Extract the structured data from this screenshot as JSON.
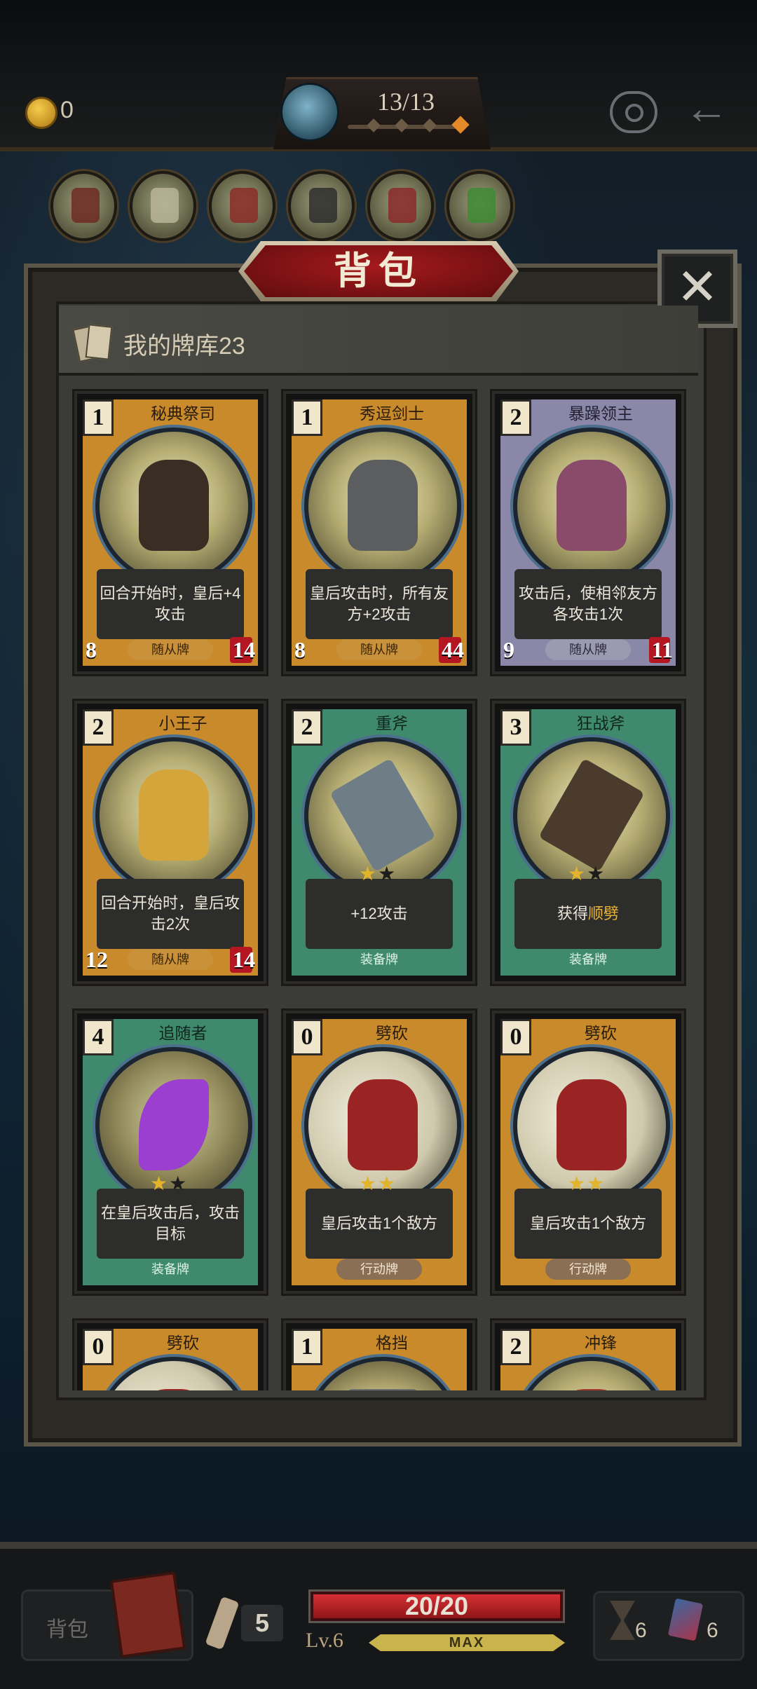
{
  "topbar": {
    "coins": "0",
    "round": "13/13"
  },
  "relics": [
    "relic-1-icon",
    "relic-2-icon",
    "relic-3-icon",
    "relic-4-icon",
    "relic-5-icon",
    "relic-6-icon"
  ],
  "panel": {
    "title": "背包",
    "close": "✕",
    "deck_label": "我的牌库23"
  },
  "cards": [
    {
      "cost": "1",
      "name": "秘典祭司",
      "desc": "回合开始时，皇后+4攻击",
      "desc_hl": "",
      "tag": "随从牌",
      "atk": "8",
      "hp": "14",
      "theme": "orange"
    },
    {
      "cost": "1",
      "name": "秀逗剑士",
      "desc": "皇后攻击时，所有友方+2攻击",
      "desc_hl": "",
      "tag": "随从牌",
      "atk": "8",
      "hp": "44",
      "theme": "orange"
    },
    {
      "cost": "2",
      "name": "暴躁领主",
      "desc": "攻击后，使相邻友方各攻击1次",
      "desc_hl": "",
      "tag": "随从牌",
      "atk": "9",
      "hp": "11",
      "theme": "purple"
    },
    {
      "cost": "2",
      "name": "小王子",
      "desc": "回合开始时，皇后攻击2次",
      "desc_hl": "",
      "tag": "随从牌",
      "atk": "12",
      "hp": "14",
      "theme": "orange"
    },
    {
      "cost": "2",
      "name": "重斧",
      "desc": "+12攻击",
      "desc_hl": "",
      "tag": "装备牌",
      "atk": "",
      "hp": "",
      "theme": "green",
      "stars": 1
    },
    {
      "cost": "3",
      "name": "狂战斧",
      "desc": "获得",
      "desc_hl": "顺劈",
      "tag": "装备牌",
      "atk": "",
      "hp": "",
      "theme": "green",
      "stars": 1
    },
    {
      "cost": "4",
      "name": "追随者",
      "desc": "在皇后攻击后，攻击目标",
      "desc_hl": "",
      "tag": "装备牌",
      "atk": "",
      "hp": "",
      "theme": "green",
      "stars": 1
    },
    {
      "cost": "0",
      "name": "劈砍",
      "desc": "皇后攻击1个敌方",
      "desc_hl": "",
      "tag": "行动牌",
      "atk": "",
      "hp": "",
      "theme": "orange",
      "stars": 2
    },
    {
      "cost": "0",
      "name": "劈砍",
      "desc": "皇后攻击1个敌方",
      "desc_hl": "",
      "tag": "行动牌",
      "atk": "",
      "hp": "",
      "theme": "orange",
      "stars": 2
    },
    {
      "cost": "0",
      "name": "劈砍",
      "desc": "",
      "desc_hl": "",
      "tag": "",
      "atk": "",
      "hp": "",
      "theme": "orange"
    },
    {
      "cost": "1",
      "name": "格挡",
      "desc": "",
      "desc_hl": "",
      "tag": "",
      "atk": "",
      "hp": "",
      "theme": "orange"
    },
    {
      "cost": "2",
      "name": "冲锋",
      "desc": "",
      "desc_hl": "",
      "tag": "",
      "atk": "",
      "hp": "",
      "theme": "orange"
    }
  ],
  "bottombar": {
    "bag_label": "背包",
    "attack": "5",
    "hp": "20/20",
    "level": "Lv.6",
    "xp": "MAX",
    "count_hourglass": "6",
    "count_cards": "6"
  },
  "colors": {
    "tag_minion": "#c9923a",
    "tag_equip": "#3f8a6e",
    "hp_bar": "#d63035",
    "title_plaque": "#7a1214"
  }
}
